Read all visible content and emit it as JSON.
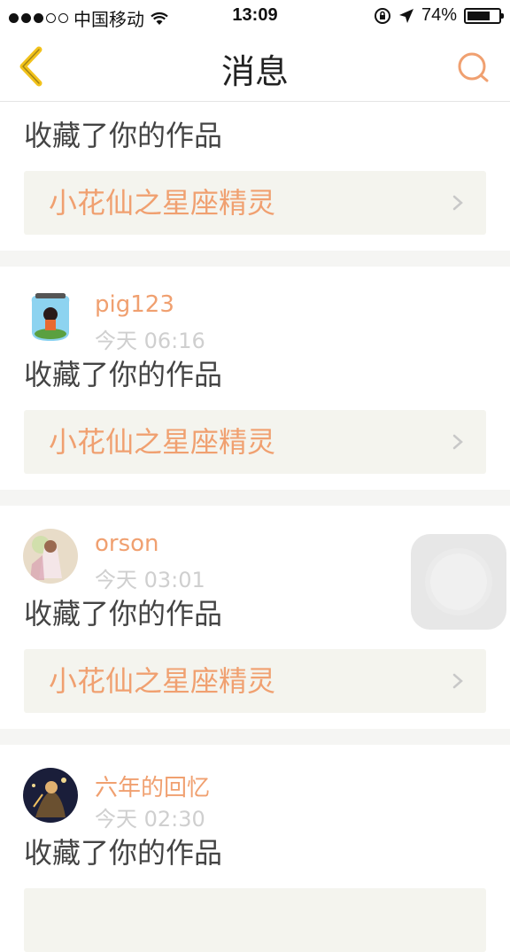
{
  "status": {
    "carrier": "中国移动",
    "time": "13:09",
    "battery_text": "74%",
    "battery_level": 0.74
  },
  "nav": {
    "title": "消息"
  },
  "colors": {
    "accent": "#f0a070",
    "back_yellow": "#f2c21b"
  },
  "messages": [
    {
      "user": "",
      "time": "",
      "action": "收藏了你的作品",
      "work": "小花仙之星座精灵"
    },
    {
      "user": "pig123",
      "time": "今天 06:16",
      "action": "收藏了你的作品",
      "work": "小花仙之星座精灵"
    },
    {
      "user": "orson",
      "time": "今天 03:01",
      "action": "收藏了你的作品",
      "work": "小花仙之星座精灵"
    },
    {
      "user": "六年的回忆",
      "time": "今天 02:30",
      "action": "收藏了你的作品",
      "work": ""
    }
  ]
}
